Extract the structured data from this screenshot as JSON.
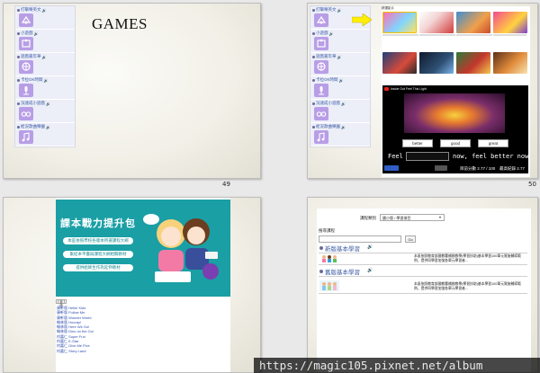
{
  "slides": [
    {
      "page_number": "49",
      "title": "GAMES",
      "sidebar": [
        {
          "label": "打擊樂英文",
          "icon": "drum-game-icon"
        },
        {
          "label": "小遊戲",
          "icon": "puzzle-icon"
        },
        {
          "label": "遊戲嘉年華",
          "icon": "ferris-icon"
        },
        {
          "label": "卡拉OK時間",
          "icon": "microphone-icon"
        },
        {
          "label": "況速成小遊戲",
          "icon": "glasses-icon"
        },
        {
          "label": "絵況歌曲樂園",
          "icon": "music-icon"
        }
      ]
    },
    {
      "page_number": "50",
      "sidebar": [
        {
          "label": "打擊樂英文",
          "icon": "drum-game-icon"
        },
        {
          "label": "小遊戲",
          "icon": "puzzle-icon"
        },
        {
          "label": "遊戲嘉年華",
          "icon": "ferris-icon"
        },
        {
          "label": "卡拉OK時間",
          "icon": "microphone-icon"
        },
        {
          "label": "況速成小遊戲",
          "icon": "glasses-icon"
        },
        {
          "label": "絵況歌曲樂園",
          "icon": "music-icon"
        }
      ],
      "video_section_header": "精選影片",
      "player": {
        "title": "Inside Out Feel This Light",
        "answers": [
          "better",
          "good",
          "great"
        ],
        "feel_prefix": "Feel",
        "feel_suffix": "now, feel better now",
        "score_text": "目前分數 2.77 / 100",
        "best_text": "最高紀錄 2.77"
      }
    },
    {
      "promo_title": "課本戰力提升包",
      "promo_items": [
        "本區依照學校各版本所選課程大綱",
        "集結本平臺與課程大綱相關教材",
        "提供給師生作為延伸教材"
      ],
      "search_button": "查詢",
      "links": [
        "康軒版 Hello! Kids",
        "康軒版 Follow Me",
        "康軒版 Wonder World",
        "翰林版 Hooray!",
        "翰林版 Here We Go!",
        "翰林版 Dino on the Go!",
        "何嘉仁 Super Fun",
        "何嘉仁 E-Star",
        "何嘉仁 Give Me Five",
        "何嘉仁 Story Land"
      ]
    },
    {
      "form": {
        "course_label": "課程類別",
        "course_value": "國小版 / 學習項目",
        "search_label": "搜尋課程",
        "go_label": "Go"
      },
      "sections": [
        {
          "title": "新版基本學習",
          "desc": "本區依照教育部國教署補救教學(學習扶助)基本學習100單元實施輔導範例，提供同學習加強各單元學習者..."
        },
        {
          "title": "舊版基本學習",
          "desc": "本區依照教育部國教署補救教學(學習扶助)基本學習100單元實施輔導範例，提供同學習加強各單元學習者..."
        }
      ]
    }
  ],
  "watermark": "https://magic105.pixnet.net/album",
  "colors": {
    "sidebar_icon": "#b89ee6",
    "promo_teal": "#1a9fa5",
    "link_blue": "#2f4fb0",
    "arrow_yellow": "#ffee00"
  }
}
